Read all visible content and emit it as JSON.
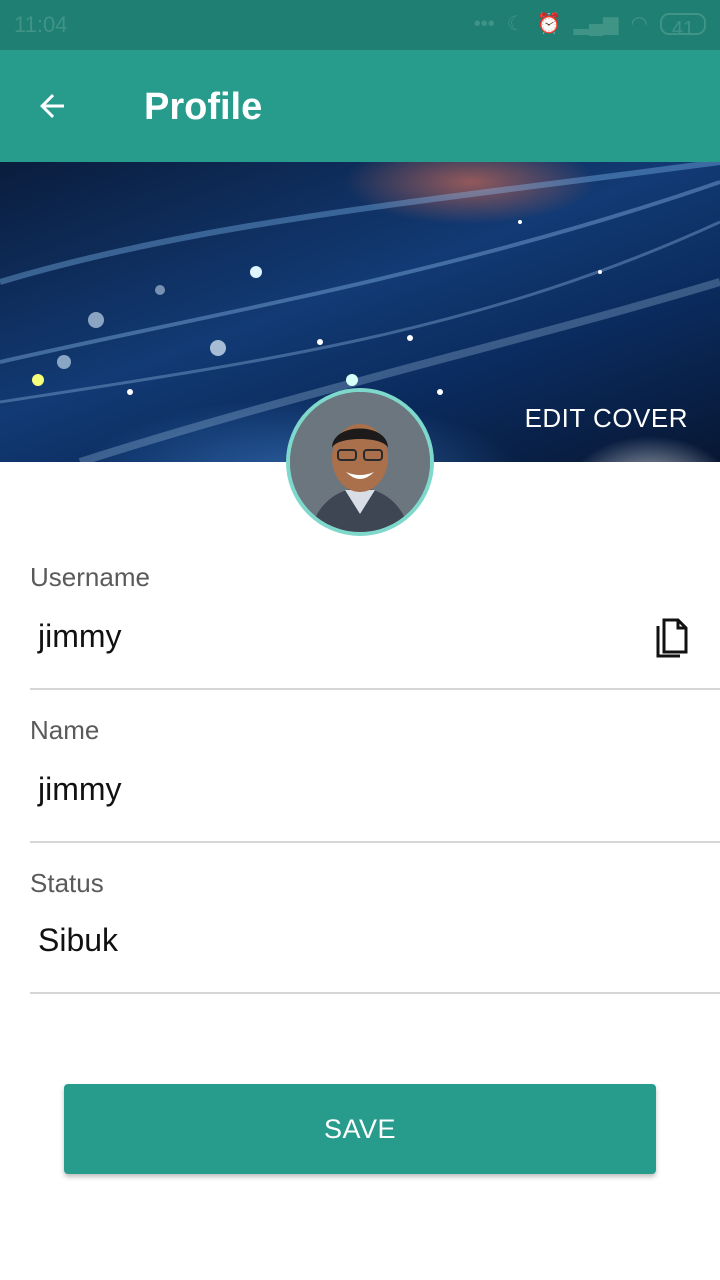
{
  "status_bar": {
    "time": "11:04",
    "icons": [
      "dots-icon",
      "moon-icon",
      "alarm-icon",
      "signal-icon",
      "wifi-icon"
    ],
    "battery": "41"
  },
  "app_bar": {
    "title": "Profile",
    "back_icon": "arrow-left-icon"
  },
  "cover": {
    "edit_label": "EDIT COVER"
  },
  "fields": {
    "username": {
      "label": "Username",
      "value": "jimmy",
      "action_icon": "copy-icon"
    },
    "name": {
      "label": "Name",
      "value": "jimmy"
    },
    "status": {
      "label": "Status",
      "value": "Sibuk"
    }
  },
  "actions": {
    "save_label": "SAVE"
  },
  "colors": {
    "primary": "#279c8d",
    "primary_dark": "#1f7f72",
    "avatar_ring": "#7fd8cc"
  }
}
